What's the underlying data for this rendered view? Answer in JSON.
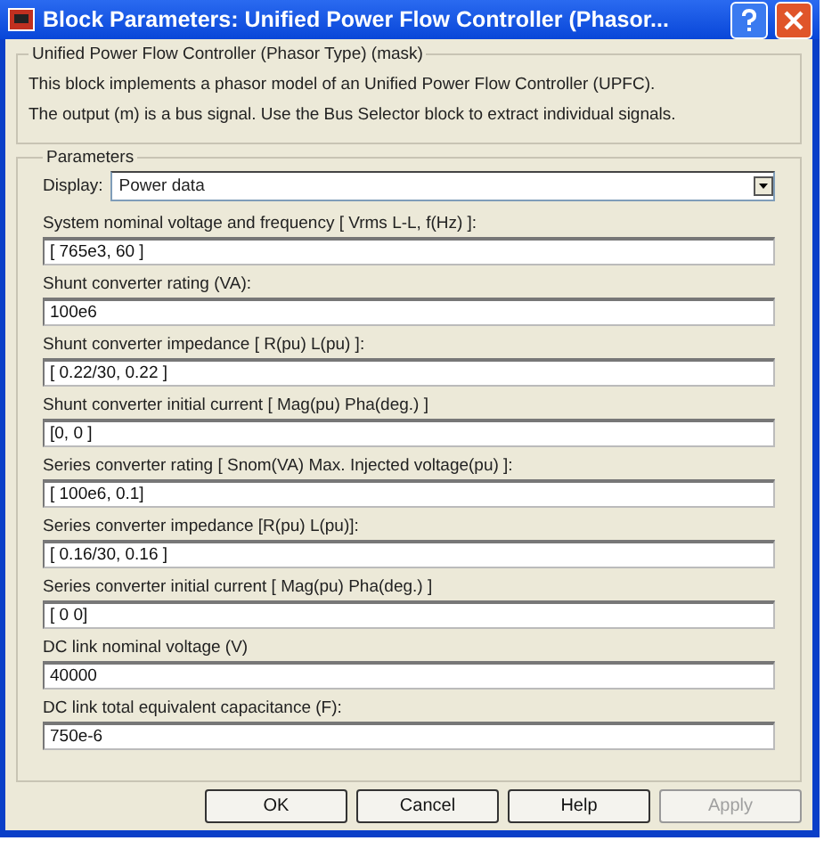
{
  "window": {
    "title": "Block Parameters: Unified Power Flow Controller (Phasor..."
  },
  "description": {
    "title": "Unified Power Flow Controller (Phasor Type) (mask)",
    "lines": [
      "This block implements a phasor model of an Unified Power Flow Controller (UPFC).",
      "The output (m) is a bus signal. Use the Bus Selector block to extract individual signals."
    ]
  },
  "parameters": {
    "title": "Parameters",
    "display": {
      "label": "Display:",
      "value": "Power data"
    },
    "fields": [
      {
        "label": "System nominal voltage and frequency [ Vrms L-L, f(Hz) ]:",
        "value": "[ 765e3, 60 ]"
      },
      {
        "label": "Shunt converter rating (VA):",
        "value": "100e6"
      },
      {
        "label": "Shunt converter impedance [ R(pu)  L(pu) ]:",
        "value": "[ 0.22/30, 0.22 ]"
      },
      {
        "label": "Shunt converter initial current [ Mag(pu)  Pha(deg.) ]",
        "value": "[0, 0 ]"
      },
      {
        "label": "Series converter rating [ Snom(VA)   Max. Injected voltage(pu) ]:",
        "value": "[ 100e6, 0.1]"
      },
      {
        "label": "Series  converter impedance [R(pu)  L(pu)]:",
        "value": "[ 0.16/30, 0.16 ]"
      },
      {
        "label": "Series converter initial current [ Mag(pu)  Pha(deg.) ]",
        "value": "[ 0 0]"
      },
      {
        "label": "DC link nominal voltage (V)",
        "value": "40000"
      },
      {
        "label": "DC link total equivalent capacitance (F):",
        "value": "750e-6"
      }
    ]
  },
  "buttons": [
    {
      "label": "OK",
      "disabled": false
    },
    {
      "label": "Cancel",
      "disabled": false
    },
    {
      "label": "Help",
      "disabled": false
    },
    {
      "label": "Apply",
      "disabled": true
    }
  ]
}
